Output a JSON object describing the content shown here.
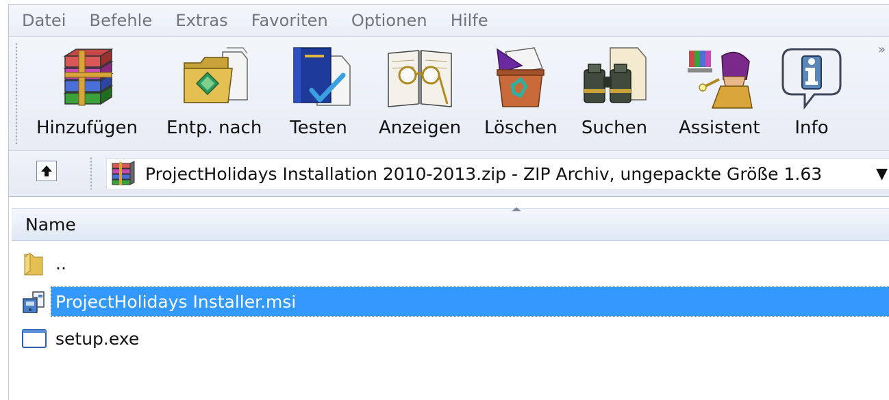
{
  "menu": [
    "Datei",
    "Befehle",
    "Extras",
    "Favoriten",
    "Optionen",
    "Hilfe"
  ],
  "toolbar": {
    "overflow": "»",
    "buttons": [
      {
        "label": "Hinzufügen",
        "icon": "archive-books-icon"
      },
      {
        "label": "Entp. nach",
        "icon": "extract-folder-icon"
      },
      {
        "label": "Testen",
        "icon": "test-check-icon"
      },
      {
        "label": "Anzeigen",
        "icon": "view-book-glasses-icon"
      },
      {
        "label": "Löschen",
        "icon": "delete-recycle-icon"
      },
      {
        "label": "Suchen",
        "icon": "find-binoculars-icon"
      },
      {
        "label": "Assistent",
        "icon": "wizard-icon"
      },
      {
        "label": "Info",
        "icon": "info-icon"
      }
    ]
  },
  "address": {
    "path": "ProjectHolidays Installation 2010-2013.zip - ZIP Archiv, ungepackte Größe 1.63",
    "dropdown": "▼"
  },
  "list": {
    "column_name": "Name",
    "rows": [
      {
        "name": "..",
        "icon": "folder-icon",
        "selected": false
      },
      {
        "name": "ProjectHolidays Installer.msi",
        "icon": "msi-installer-icon",
        "selected": true
      },
      {
        "name": "setup.exe",
        "icon": "exe-file-icon",
        "selected": false
      }
    ]
  },
  "colors": {
    "selection": "#3399ff",
    "menu_text": "#6f7580"
  }
}
